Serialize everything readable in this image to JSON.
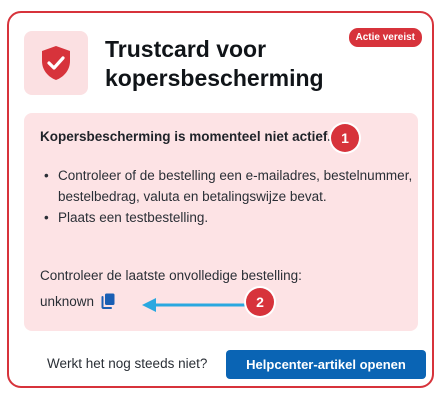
{
  "card": {
    "title": "Trustcard voor kopersbescherming",
    "badge": "Actie vereist"
  },
  "alert": {
    "heading": "Kopersbescherming is momenteel niet actief.",
    "items": [
      "Controleer of de bestelling een e-mailadres, bestelnummer, bestelbedrag, valuta en betalingswijze bevat.",
      "Plaats een testbestelling."
    ],
    "last_order_label": "Controleer de laatste onvolledige bestelling:",
    "last_order_value": "unknown"
  },
  "markers": [
    "1",
    "2"
  ],
  "footer": {
    "prompt": "Werkt het nog steeds niet?",
    "button_label": "Helpcenter-artikel openen"
  },
  "colors": {
    "accent": "#d7333b",
    "alert_bg": "#fde3e5",
    "logo_bg": "#fbe0e2",
    "button_bg": "#0a64b4",
    "arrow": "#2aa8e0",
    "copy_icon": "#1a5fb4"
  },
  "icons": {
    "logo": "shield-check-icon",
    "copy": "copy-icon",
    "annotation": "arrow-left-icon"
  }
}
